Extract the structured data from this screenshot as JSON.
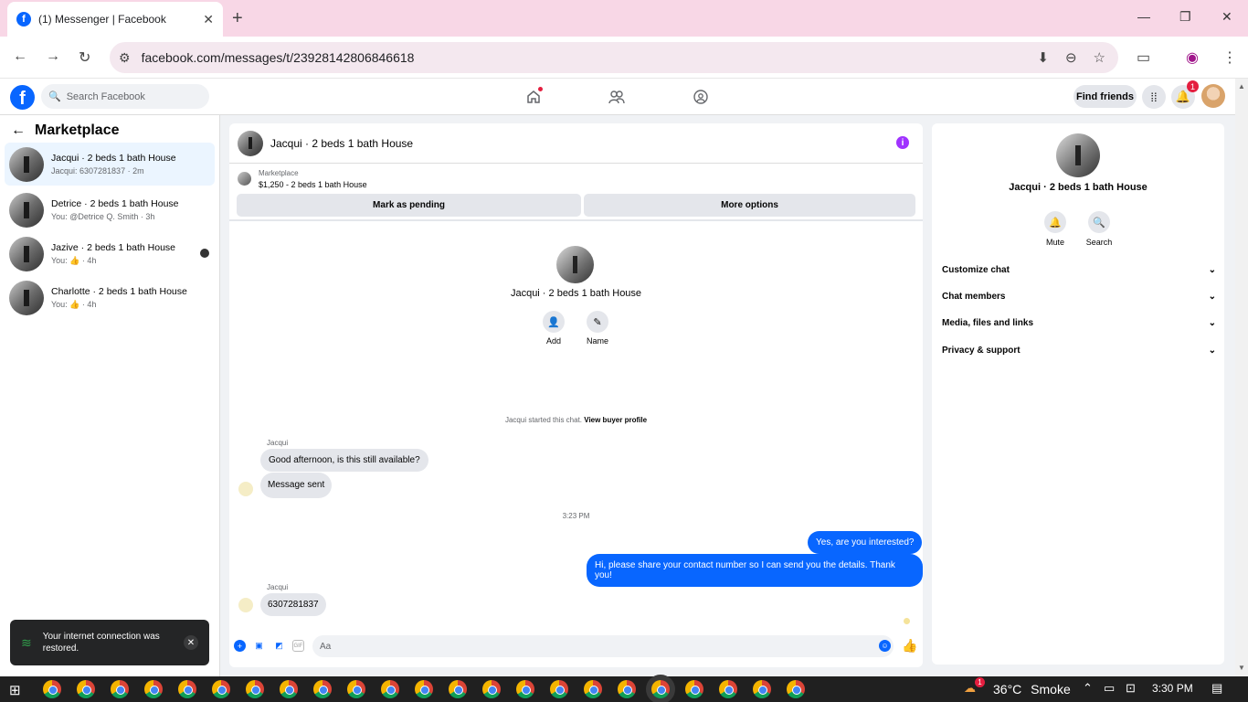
{
  "browser": {
    "tab_title": "(1) Messenger | Facebook",
    "url": "facebook.com/messages/t/23928142806846618",
    "new_tab": "+",
    "tab_close": "✕"
  },
  "fb_header": {
    "search_placeholder": "Search Facebook",
    "find_friends": "Find friends",
    "notification_count": "1"
  },
  "sidebar": {
    "title": "Marketplace",
    "conversations": [
      {
        "name": "Jacqui · 2 beds 1 bath House",
        "sub": "Jacqui: 6307281837 · 2m",
        "active": true
      },
      {
        "name": "Detrice · 2 beds 1 bath House",
        "sub": "You: @Detrice Q. Smith · 3h",
        "active": false
      },
      {
        "name": "Jazive · 2 beds 1 bath House",
        "sub": "You: 👍 · 4h",
        "active": false
      },
      {
        "name": "Charlotte · 2 beds 1 bath House",
        "sub": "You: 👍 · 4h",
        "active": false
      }
    ]
  },
  "toast": {
    "text": "Your internet connection was restored."
  },
  "chat": {
    "title": "Jacqui · 2 beds 1 bath House",
    "marketplace_label": "Marketplace",
    "listing": "$1,250 - 2 beds 1 bath House",
    "mark_pending": "Mark as pending",
    "more_options": "More options",
    "center_name": "Jacqui · 2 beds 1 bath House",
    "add_label": "Add",
    "name_label": "Name",
    "started_text": "Jacqui started this chat.",
    "view_profile": "View buyer profile",
    "sender_name": "Jacqui",
    "msg1": "Good afternoon, is this still available?",
    "msg2": "Message sent",
    "timestamp": "3:23 PM",
    "msg3": "Yes, are you interested?",
    "msg4": "Hi, please share your contact number so I can send you the details. Thank you!",
    "sender_name2": "Jacqui",
    "msg5": "6307281837",
    "composer_placeholder": "Aa"
  },
  "right_panel": {
    "name": "Jacqui · 2 beds 1 bath House",
    "mute": "Mute",
    "search": "Search",
    "sections": [
      "Customize chat",
      "Chat members",
      "Media, files and links",
      "Privacy & support"
    ]
  },
  "taskbar": {
    "temperature": "36°C",
    "weather": "Smoke",
    "time": "3:30 PM",
    "weather_badge": "1"
  }
}
